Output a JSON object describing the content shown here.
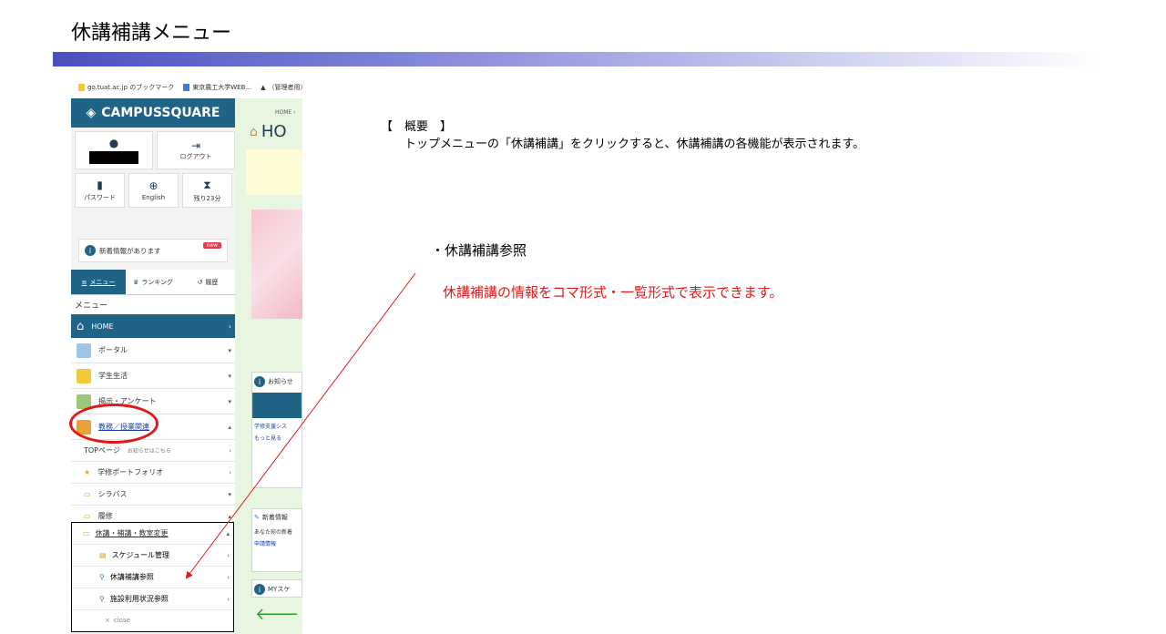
{
  "slide": {
    "title": "休講補講メニュー"
  },
  "browser": {
    "bookmarks": [
      {
        "label": "go.tuat.ac.jp のブックマーク",
        "icon": "folder-icon"
      },
      {
        "label": "東京農工大学WEB...",
        "icon": "page-icon"
      },
      {
        "label": "（管理者用）",
        "icon": "warning-icon"
      }
    ]
  },
  "sidebar": {
    "brand": "CAMPUSSQUARE",
    "logout": "ログアウト",
    "password": "パスワード",
    "english": "English",
    "remaining": "残り23分",
    "notice": "新着情報があります",
    "notice_badge": "new",
    "tab_menu": "メニュー",
    "tab_ranking": "ランキング",
    "tab_history": "履歴",
    "menu_label": "メニュー",
    "home": "HOME",
    "portal": "ポータル",
    "student_life": "学生生活",
    "survey": "揭示・アンケート",
    "academic": "教務／授業関連",
    "top_page": "TOPページ",
    "top_page_note": "お知らせはこちら",
    "portfolio": "学修ポートフォリオ",
    "syllabus": "シラバス",
    "enrollment": "履修"
  },
  "popup": {
    "header": "休講・補講・教室変更",
    "schedule": "スケジュール管理",
    "lecture_ref": "休講補講参照",
    "facility_ref": "施設利用状況参照",
    "close": "close"
  },
  "main": {
    "crumb": "HOME ›",
    "home_heading": "HO",
    "news": "お知らせ",
    "study_system": "学修支援シス",
    "more": "もっと見る",
    "new_info": "新着情報",
    "your_news": "あなた宛の新着",
    "apply_info": "申請情報",
    "my_schedule": "MYスケ"
  },
  "content": {
    "outline_head": "【　概要　】",
    "outline_desc": "トップメニューの「休講補講」をクリックすると、休講補講の各機能が表示されます。",
    "feature_title": "・休講補講参照",
    "feature_desc": "休講補講の情報をコマ形式・一覧形式で表示できます。"
  },
  "colors": {
    "accent": "#1f6486",
    "highlight": "#e21818",
    "link": "#1a3ea8"
  }
}
